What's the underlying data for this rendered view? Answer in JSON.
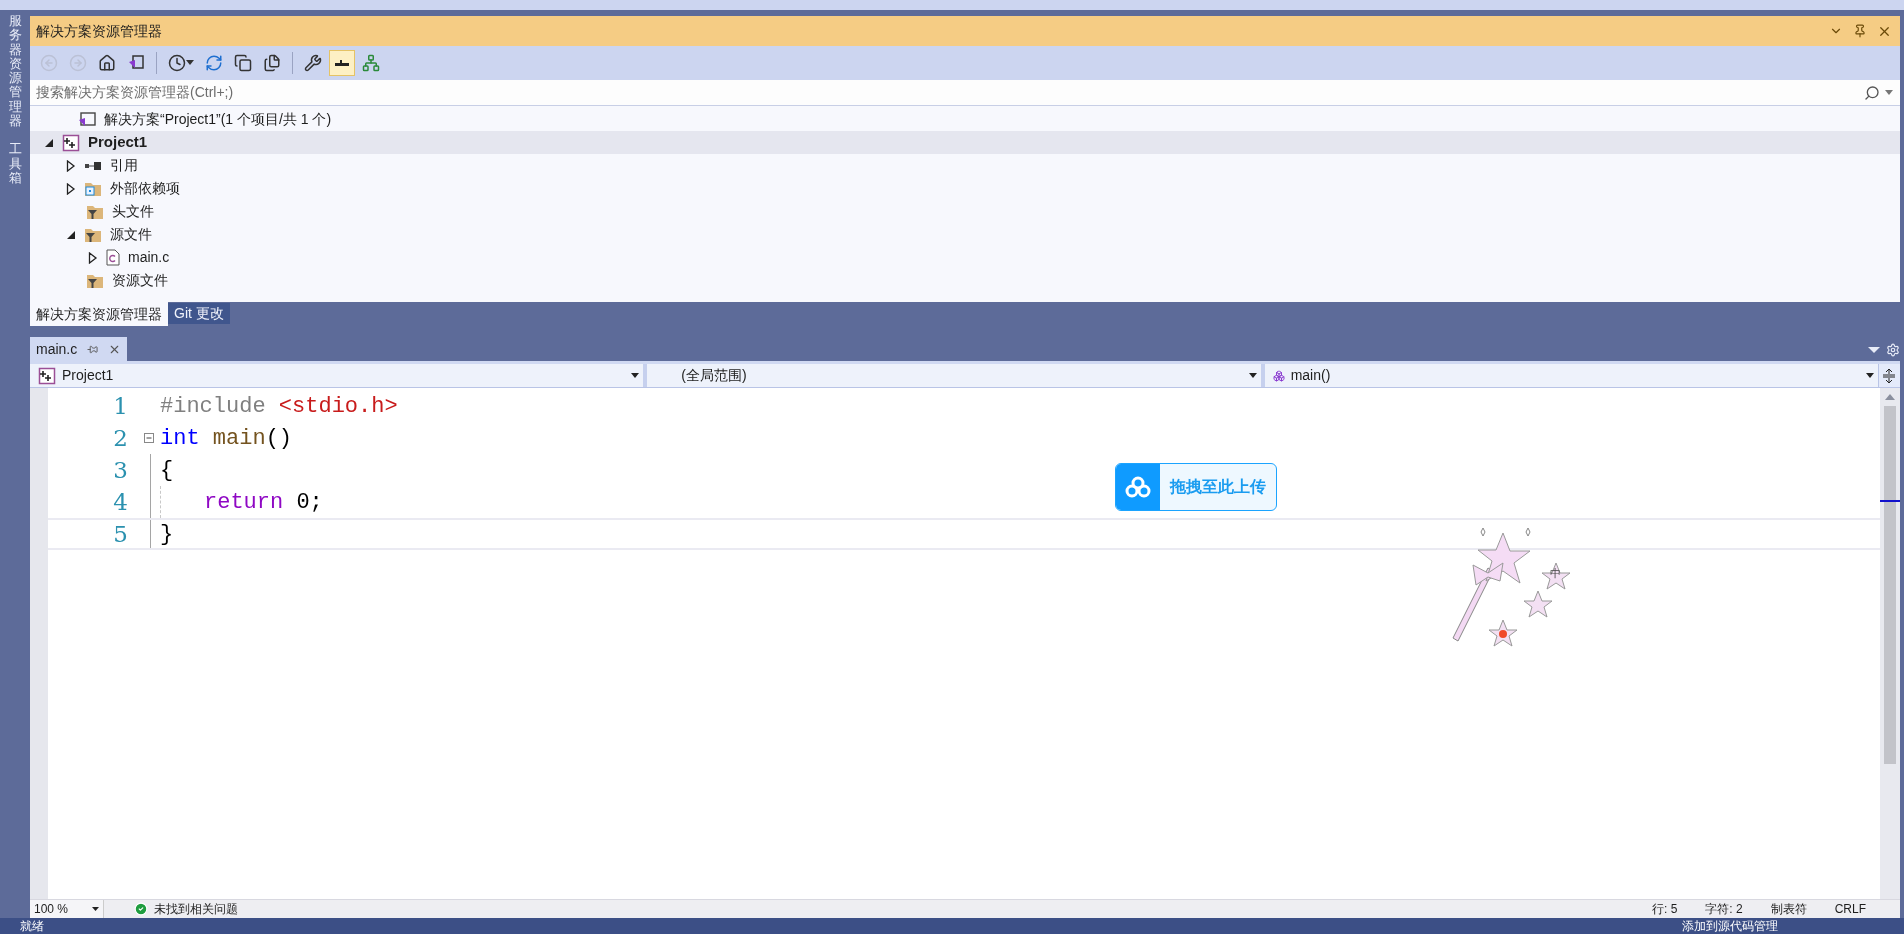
{
  "side_tabs": [
    {
      "label": "服务器资源管理器"
    },
    {
      "label": "工具箱"
    }
  ],
  "solution_explorer": {
    "title": "解决方案资源管理器",
    "toolbar": [
      {
        "kind": "back",
        "disabled": true,
        "pressed": false
      },
      {
        "kind": "forward",
        "disabled": true,
        "pressed": false
      },
      {
        "kind": "home",
        "disabled": false,
        "pressed": false
      },
      {
        "kind": "switch-view",
        "disabled": false,
        "pressed": false
      },
      {
        "kind": "separator"
      },
      {
        "kind": "history",
        "disabled": false,
        "pressed": false
      },
      {
        "kind": "sync",
        "disabled": false,
        "pressed": false
      },
      {
        "kind": "collapse",
        "disabled": false,
        "pressed": false
      },
      {
        "kind": "copy",
        "disabled": false,
        "pressed": false
      },
      {
        "kind": "separator"
      },
      {
        "kind": "properties",
        "disabled": false,
        "pressed": false
      },
      {
        "kind": "preview",
        "disabled": false,
        "pressed": true
      },
      {
        "kind": "diagram",
        "disabled": false,
        "pressed": false
      }
    ],
    "search": {
      "placeholder": "搜索解决方案资源管理器(Ctrl+;)"
    },
    "solution": {
      "label": "解决方案“Project1”(1 个项目/共 1 个)"
    },
    "tree": [
      {
        "label": "Project1",
        "kind": "project",
        "expanded": true,
        "selected": true,
        "children": [
          {
            "label": "引用",
            "kind": "references",
            "expanded": false,
            "selected": false
          },
          {
            "label": "外部依赖项",
            "kind": "external",
            "expanded": false,
            "selected": false
          },
          {
            "label": "头文件",
            "kind": "filter",
            "selected": false
          },
          {
            "label": "源文件",
            "kind": "filter",
            "expanded": true,
            "selected": false,
            "children": [
              {
                "label": "main.c",
                "kind": "file",
                "expanded": false,
                "selected": false
              }
            ]
          },
          {
            "label": "资源文件",
            "kind": "filter",
            "selected": false
          }
        ]
      }
    ],
    "bottom_tabs": [
      {
        "label": "解决方案资源管理器",
        "selected": true
      },
      {
        "label": "Git 更改",
        "selected": false
      }
    ]
  },
  "editor": {
    "tabs": [
      {
        "label": "main.c",
        "selected": true
      }
    ],
    "nav": [
      {
        "kind": "project",
        "label": "Project1"
      },
      {
        "kind": "scope",
        "label": "(全局范围)"
      },
      {
        "kind": "member",
        "label": "main()"
      }
    ],
    "lines": [
      {
        "number": "1",
        "fold": false,
        "current": false,
        "indent": false,
        "tokens": [
          {
            "kind": "preprocessor",
            "text": "#include "
          },
          {
            "kind": "string",
            "text": "<stdio.h>"
          }
        ]
      },
      {
        "number": "2",
        "fold": true,
        "current": false,
        "indent": false,
        "tokens": [
          {
            "kind": "keyword",
            "text": "int "
          },
          {
            "kind": "function",
            "text": "main"
          },
          {
            "kind": "plain",
            "text": "()"
          }
        ]
      },
      {
        "number": "3",
        "fold": false,
        "current": false,
        "indent": false,
        "tokens": [
          {
            "kind": "plain",
            "text": "{"
          }
        ]
      },
      {
        "number": "4",
        "fold": false,
        "current": false,
        "indent": true,
        "tokens": [
          {
            "kind": "control",
            "text": "return"
          },
          {
            "kind": "plain",
            "text": " 0;"
          }
        ]
      },
      {
        "number": "5",
        "fold": false,
        "current": true,
        "indent": false,
        "tokens": [
          {
            "kind": "plain",
            "text": "}"
          }
        ]
      }
    ],
    "status": {
      "zoom": "100 %",
      "issues": "未找到相关问题",
      "fields": [
        "行: 5",
        "字符: 2",
        "制表符",
        "CRLF"
      ]
    }
  },
  "overlay": {
    "upload": "拖拽至此上传",
    "ime": "中"
  },
  "status_bar": {
    "left": "就绪",
    "right": "添加到源代码管理"
  }
}
